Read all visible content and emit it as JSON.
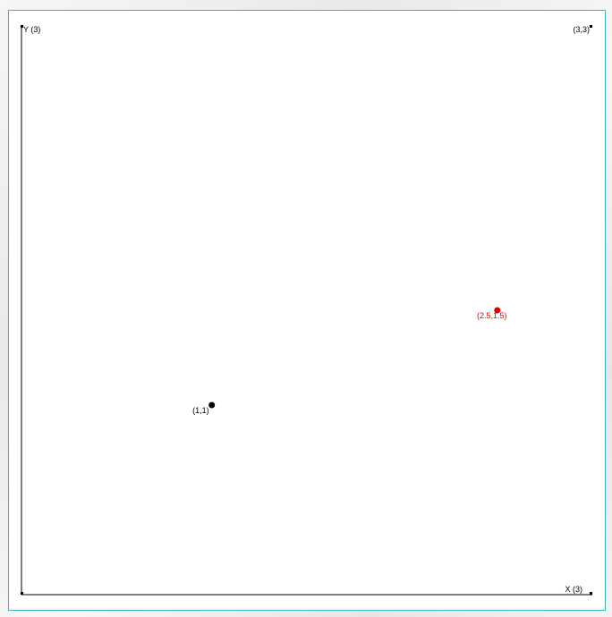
{
  "axes": {
    "x_label": "X (3)",
    "y_label": "Y (3)",
    "corner_label": "(3,3)",
    "x_range": [
      0,
      3
    ],
    "y_range": [
      0,
      3
    ]
  },
  "points": [
    {
      "x": 1,
      "y": 1,
      "label": "(1,1)",
      "color": "#000000"
    },
    {
      "x": 2.5,
      "y": 1.5,
      "label": "(2.5,1.5)",
      "color": "#dd0000"
    }
  ],
  "colors": {
    "axis": "#000000",
    "panel_border": "#3fb0c0"
  }
}
